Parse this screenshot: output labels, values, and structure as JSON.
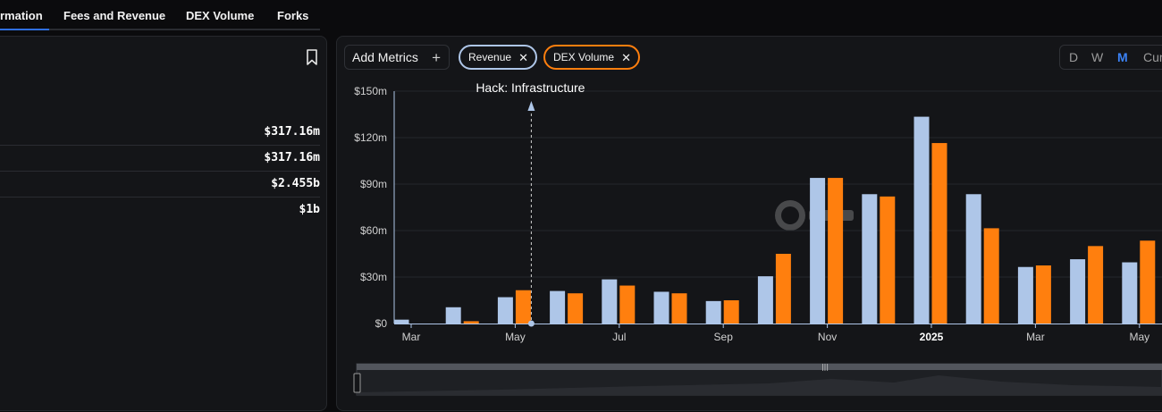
{
  "tabs": [
    {
      "label": "rmation",
      "active": true
    },
    {
      "label": "Fees and Revenue",
      "active": false
    },
    {
      "label": "DEX Volume",
      "active": false
    },
    {
      "label": "Forks",
      "active": false
    }
  ],
  "left_panel": {
    "stats": [
      {
        "value": "$317.16m"
      },
      {
        "value": "$317.16m"
      },
      {
        "value": "$2.455b"
      },
      {
        "value": "$1b"
      }
    ]
  },
  "toolbar": {
    "add_metrics_label": "Add Metrics",
    "add_icon": "plus-icon",
    "close_icon": "close-icon",
    "metric_pills": [
      {
        "label": "Revenue",
        "color": "#aec6e8"
      },
      {
        "label": "DEX Volume",
        "color": "#ff7f0e"
      }
    ],
    "granularity": [
      "D",
      "W",
      "M",
      "Cum"
    ],
    "granularity_selected": "M"
  },
  "chart_data": {
    "type": "bar",
    "ylim": [
      0,
      150
    ],
    "y_ticks": [
      "$0",
      "$30m",
      "$60m",
      "$90m",
      "$120m",
      "$150m"
    ],
    "x_tick_labels": [
      {
        "label": "Mar",
        "index": 0,
        "bold": false
      },
      {
        "label": "May",
        "index": 2,
        "bold": false
      },
      {
        "label": "Jul",
        "index": 4,
        "bold": false
      },
      {
        "label": "Sep",
        "index": 6,
        "bold": false
      },
      {
        "label": "Nov",
        "index": 8,
        "bold": false
      },
      {
        "label": "2025",
        "index": 10,
        "bold": true
      },
      {
        "label": "Mar",
        "index": 12,
        "bold": false
      },
      {
        "label": "May",
        "index": 14,
        "bold": false
      }
    ],
    "series": [
      {
        "name": "Revenue",
        "color": "#aec6e8",
        "values": [
          2.5,
          10.5,
          17,
          21,
          28.5,
          20.5,
          14.5,
          30.5,
          94,
          83.5,
          133.5,
          83.5,
          36.5,
          41.5,
          39.5
        ]
      },
      {
        "name": "DEX Volume",
        "color": "#ff7f0e",
        "values": [
          0,
          1.5,
          21.5,
          19.5,
          24.5,
          19.5,
          15,
          45,
          94,
          82,
          116.5,
          61.5,
          37.5,
          50,
          53.5
        ]
      }
    ],
    "annotation": {
      "label": "Hack: Infrastructure",
      "index": 2
    }
  }
}
